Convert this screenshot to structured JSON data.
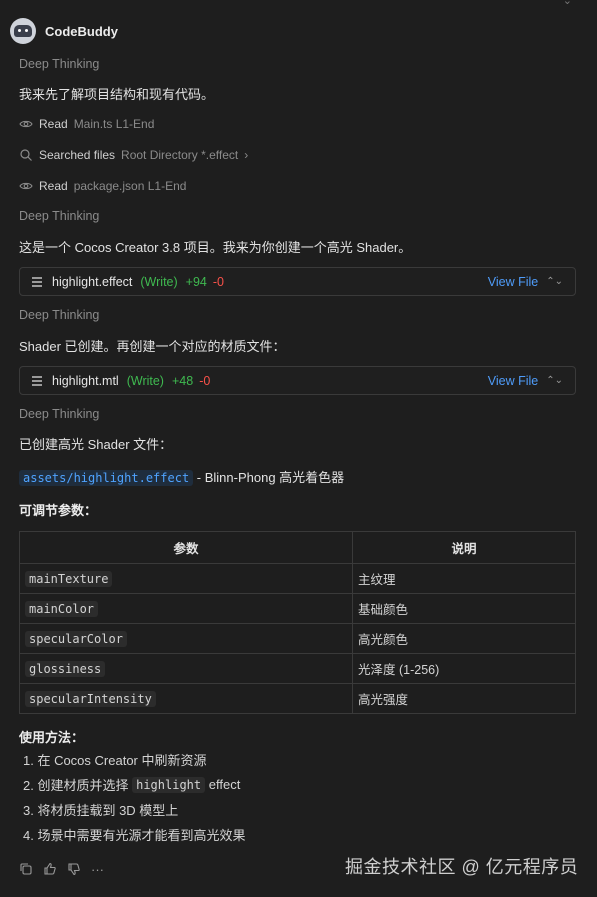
{
  "header": {
    "name": "CodeBuddy"
  },
  "sections": {
    "thinking_label": "Deep Thinking",
    "msg1": "我来先了解项目结构和现有代码。",
    "tool1": {
      "verb": "Read",
      "meta": "Main.ts L1-End"
    },
    "tool2": {
      "verb": "Searched files",
      "meta": "Root Directory *.effect"
    },
    "tool3": {
      "verb": "Read",
      "meta": "package.json L1-End"
    },
    "msg2": "这是一个 Cocos Creator 3.8 项目。我来为你创建一个高光 Shader。",
    "file1": {
      "name": "highlight.effect",
      "op": "(Write)",
      "add": "+94",
      "del": "-0",
      "view": "View File"
    },
    "msg3": "Shader 已创建。再创建一个对应的材质文件：",
    "file2": {
      "name": "highlight.mtl",
      "op": "(Write)",
      "add": "+48",
      "del": "-0",
      "view": "View File"
    },
    "msg4": "已创建高光 Shader 文件：",
    "asset_path": "assets/highlight.effect",
    "asset_desc": " - Blinn-Phong 高光着色器",
    "params_title": "可调节参数：",
    "table": {
      "headers": [
        "参数",
        "说明"
      ],
      "rows": [
        [
          "mainTexture",
          "主纹理"
        ],
        [
          "mainColor",
          "基础颜色"
        ],
        [
          "specularColor",
          "高光颜色"
        ],
        [
          "glossiness",
          "光泽度 (1-256)"
        ],
        [
          "specularIntensity",
          "高光强度"
        ]
      ]
    },
    "usage_title": "使用方法：",
    "steps": {
      "s1": "1. 在 Cocos Creator 中刷新资源",
      "s2a": "2. 创建材质并选择",
      "s2code": "highlight",
      "s2b": "effect",
      "s3": "3. 将材质挂载到 3D 模型上",
      "s4": "4. 场景中需要有光源才能看到高光效果"
    }
  },
  "watermark": "掘金技术社区 @ 亿元程序员"
}
